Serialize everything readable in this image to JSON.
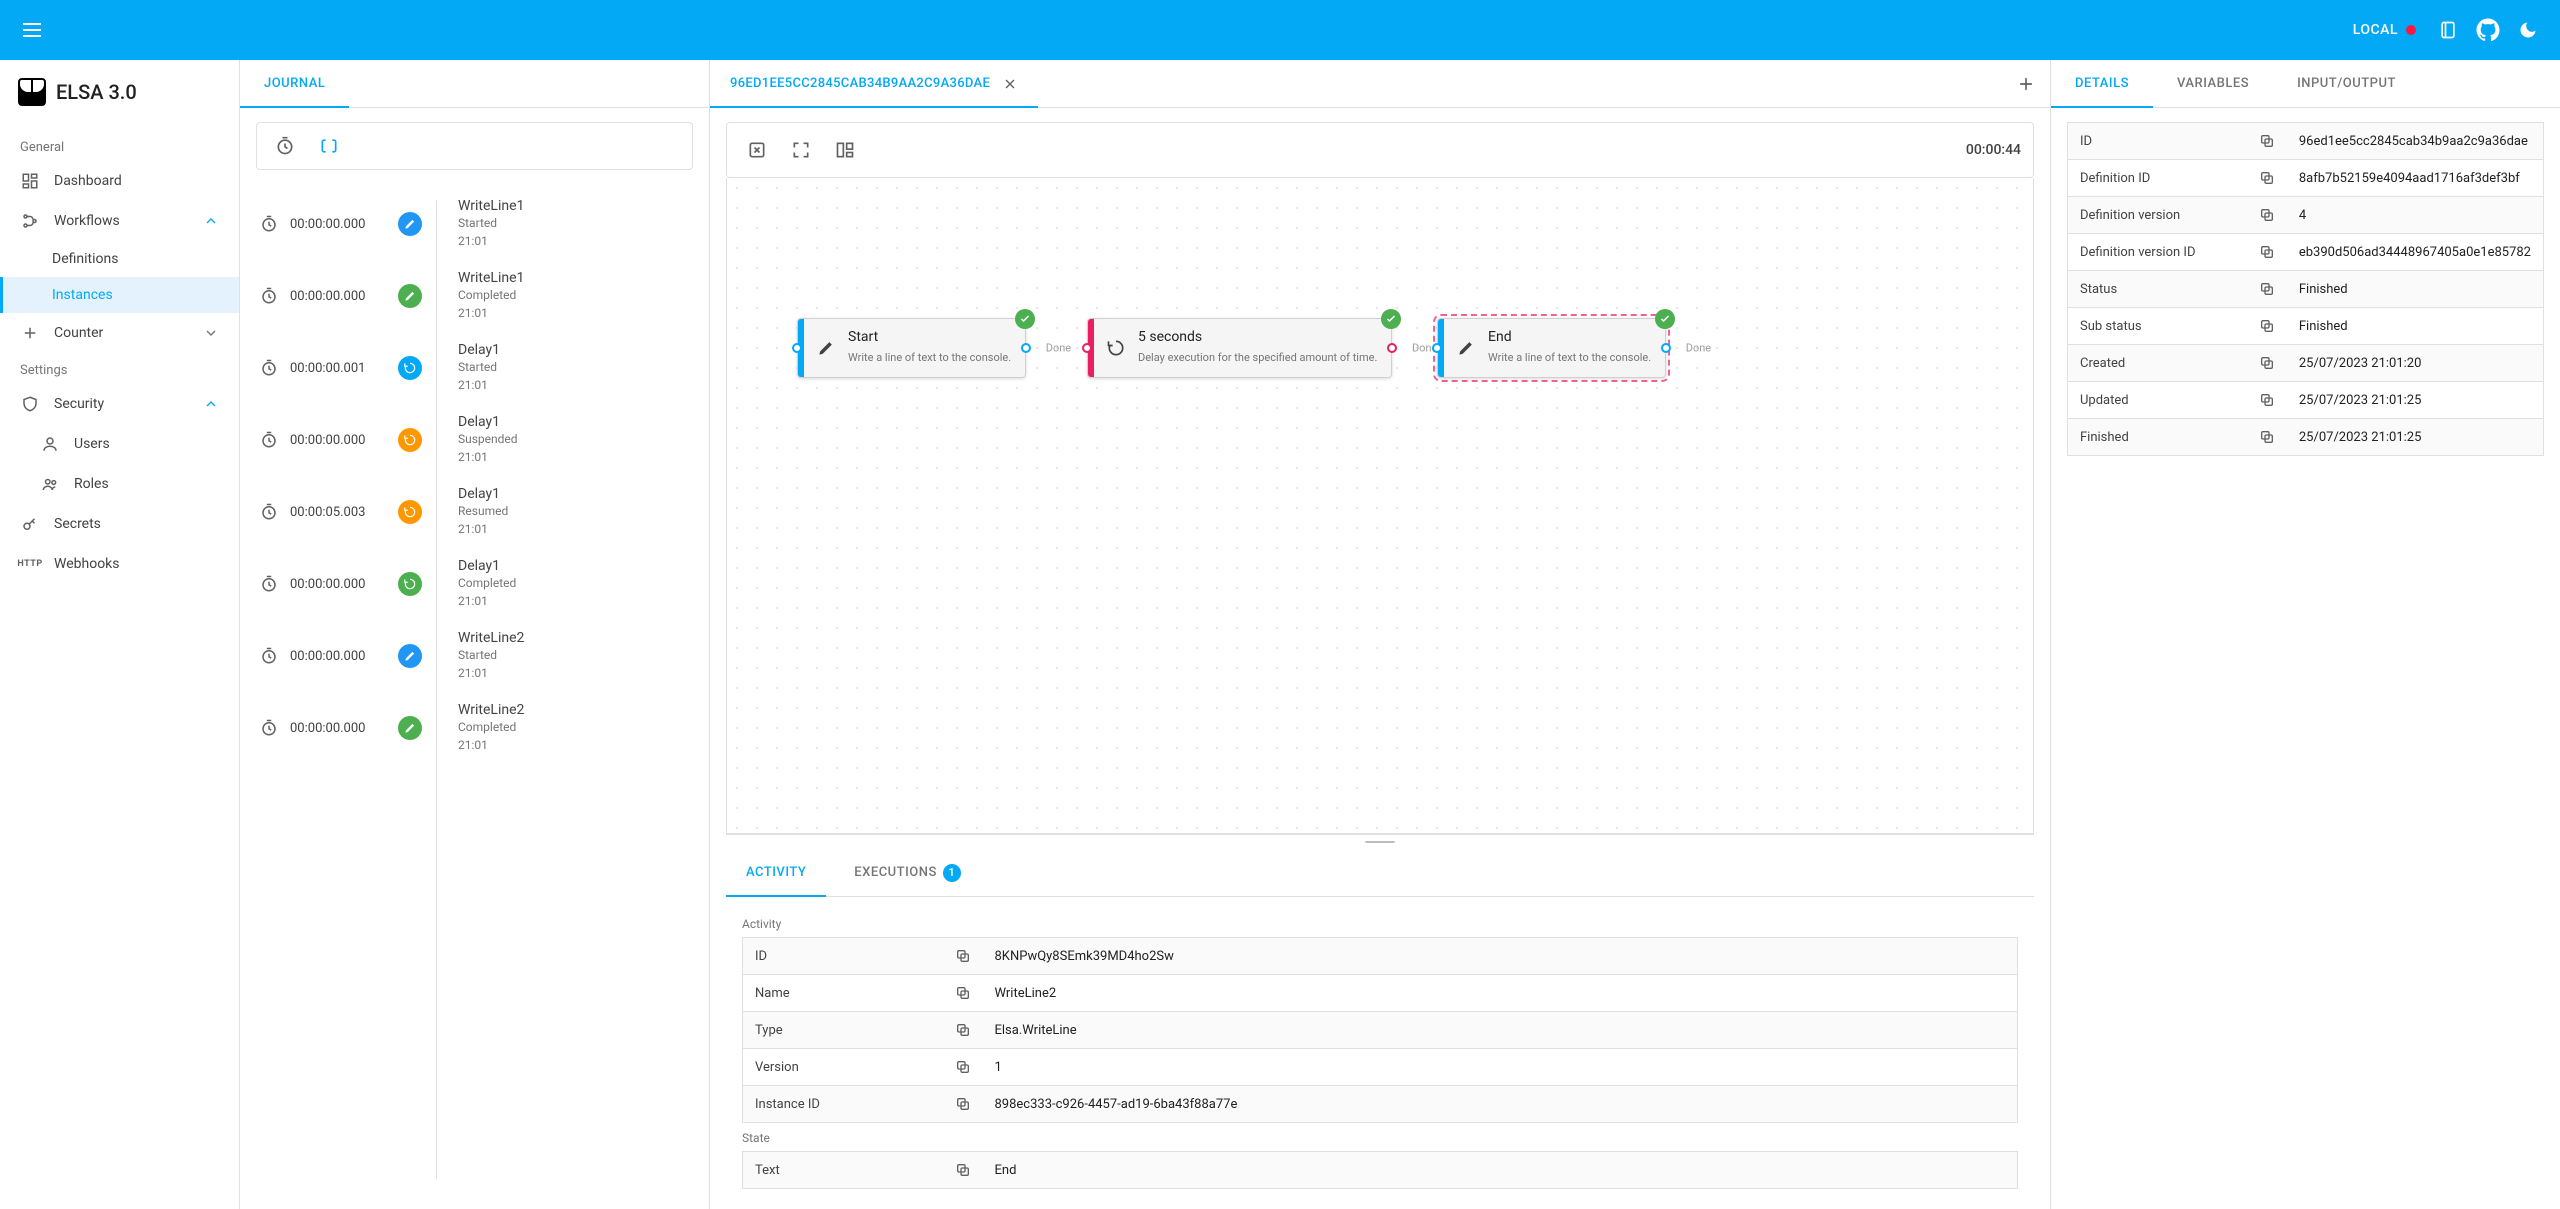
{
  "header": {
    "env": "LOCAL"
  },
  "brand": "ELSA 3.0",
  "sidebar": {
    "sections": [
      {
        "label": "General",
        "items": [
          {
            "id": "dashboards",
            "label": "Dashboard",
            "icon": "dashboard"
          },
          {
            "id": "workflows",
            "label": "Workflows",
            "icon": "workflow",
            "expanded": true,
            "children": [
              {
                "id": "definitions",
                "label": "Definitions"
              },
              {
                "id": "instances",
                "label": "Instances",
                "active": true
              }
            ]
          },
          {
            "id": "counter",
            "label": "Counter",
            "icon": "plus",
            "expandable": true
          }
        ]
      },
      {
        "label": "Settings",
        "items": [
          {
            "id": "security",
            "label": "Security",
            "icon": "shield",
            "expanded": true,
            "children": [
              {
                "id": "users",
                "label": "Users",
                "icon": "user"
              },
              {
                "id": "roles",
                "label": "Roles",
                "icon": "group"
              }
            ]
          },
          {
            "id": "secrets",
            "label": "Secrets",
            "icon": "key"
          },
          {
            "id": "webhooks",
            "label": "Webhooks",
            "icon": "http"
          }
        ]
      }
    ]
  },
  "journal": {
    "tabLabel": "JOURNAL",
    "events": [
      {
        "ts": "00:00:00.000",
        "color": "blue",
        "glyph": "pen",
        "title": "WriteLine1",
        "status": "Started",
        "time": "21:01"
      },
      {
        "ts": "00:00:00.000",
        "color": "green",
        "glyph": "pen",
        "title": "WriteLine1",
        "status": "Completed",
        "time": "21:01"
      },
      {
        "ts": "00:00:00.001",
        "color": "cyan",
        "glyph": "spin",
        "title": "Delay1",
        "status": "Started",
        "time": "21:01"
      },
      {
        "ts": "00:00:00.000",
        "color": "orange",
        "glyph": "spin",
        "title": "Delay1",
        "status": "Suspended",
        "time": "21:01"
      },
      {
        "ts": "00:00:05.003",
        "color": "orange",
        "glyph": "spin",
        "title": "Delay1",
        "status": "Resumed",
        "time": "21:01"
      },
      {
        "ts": "00:00:00.000",
        "color": "green",
        "glyph": "spin",
        "title": "Delay1",
        "status": "Completed",
        "time": "21:01"
      },
      {
        "ts": "00:00:00.000",
        "color": "blue",
        "glyph": "pen",
        "title": "WriteLine2",
        "status": "Started",
        "time": "21:01"
      },
      {
        "ts": "00:00:00.000",
        "color": "green",
        "glyph": "pen",
        "title": "WriteLine2",
        "status": "Completed",
        "time": "21:01"
      }
    ]
  },
  "canvasTab": {
    "title": "96ED1EE5CC2845CAB34B9AA2C9A36DAE"
  },
  "canvas": {
    "elapsed": "00:00:44",
    "nodes": [
      {
        "id": "n1",
        "title": "Start",
        "desc": "Write a line of text to the console.",
        "accent": "blue",
        "icon": "pen",
        "doneLabel": "Done",
        "highlight": false
      },
      {
        "id": "n2",
        "title": "5 seconds",
        "desc": "Delay execution for the specified amount of time.",
        "accent": "pink",
        "icon": "spin",
        "doneLabel": "Done",
        "highlight": false
      },
      {
        "id": "n3",
        "title": "End",
        "desc": "Write a line of text to the console.",
        "accent": "blue",
        "icon": "pen",
        "doneLabel": "Done",
        "highlight": true
      }
    ]
  },
  "bottom": {
    "tabs": {
      "activity": "ACTIVITY",
      "executions": "EXECUTIONS",
      "executionsCount": "1"
    },
    "sections": [
      {
        "label": "Activity",
        "rows": [
          {
            "k": "ID",
            "copy": true,
            "v": "8KNPwQy8SEmk39MD4ho2Sw"
          },
          {
            "k": "Name",
            "copy": true,
            "v": "WriteLine2"
          },
          {
            "k": "Type",
            "copy": true,
            "v": "Elsa.WriteLine"
          },
          {
            "k": "Version",
            "copy": true,
            "v": "1"
          },
          {
            "k": "Instance ID",
            "copy": true,
            "v": "898ec333-c926-4457-ad19-6ba43f88a77e"
          }
        ]
      },
      {
        "label": "State",
        "rows": [
          {
            "k": "Text",
            "copy": true,
            "v": "End"
          }
        ]
      }
    ]
  },
  "details": {
    "tabs": {
      "details": "DETAILS",
      "variables": "VARIABLES",
      "io": "INPUT/OUTPUT"
    },
    "rows": [
      {
        "k": "ID",
        "copy": true,
        "v": "96ed1ee5cc2845cab34b9aa2c9a36dae"
      },
      {
        "k": "Definition ID",
        "copy": true,
        "v": "8afb7b52159e4094aad1716af3def3bf"
      },
      {
        "k": "Definition version",
        "copy": true,
        "v": "4"
      },
      {
        "k": "Definition version ID",
        "copy": true,
        "v": "eb390d506ad34448967405a0e1e85782"
      },
      {
        "k": "Status",
        "copy": true,
        "v": "Finished"
      },
      {
        "k": "Sub status",
        "copy": true,
        "v": "Finished"
      },
      {
        "k": "Created",
        "copy": true,
        "v": "25/07/2023 21:01:20"
      },
      {
        "k": "Updated",
        "copy": true,
        "v": "25/07/2023 21:01:25"
      },
      {
        "k": "Finished",
        "copy": true,
        "v": "25/07/2023 21:01:25"
      }
    ]
  }
}
